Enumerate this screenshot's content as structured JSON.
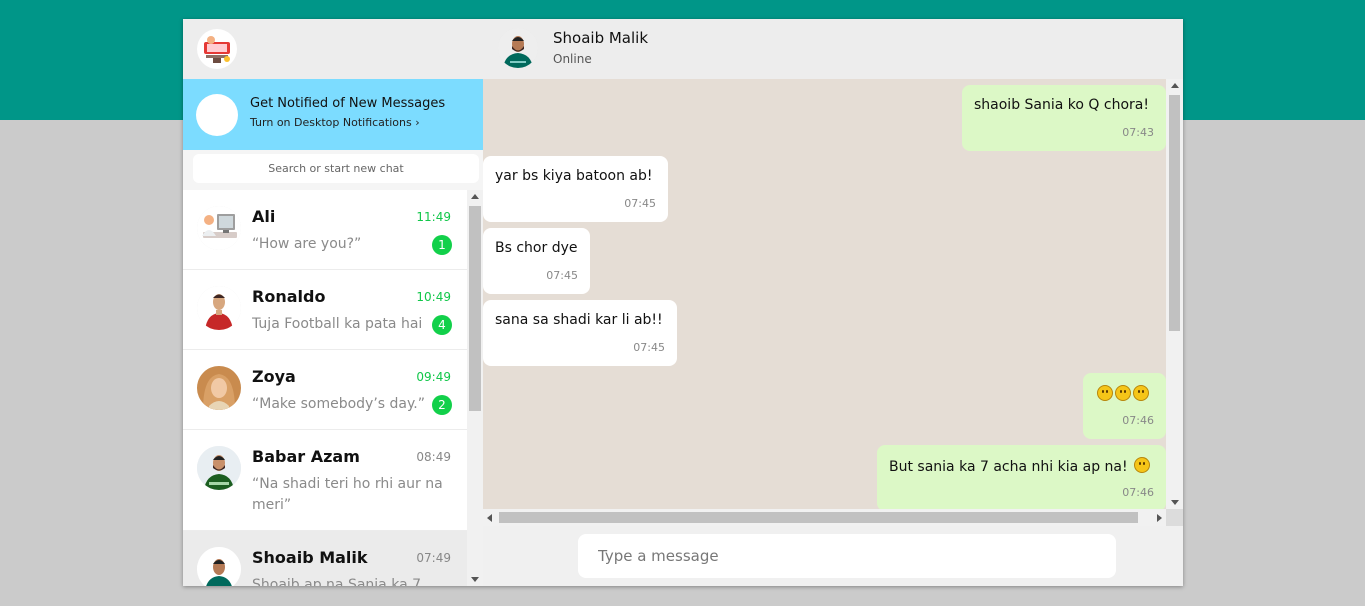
{
  "sidebar": {
    "notification": {
      "title": "Get Notified of New Messages",
      "subtitle": "Turn on Desktop Notifications ›"
    },
    "search": {
      "placeholder": "Search or start new chat"
    },
    "chats": [
      {
        "name": "Ali",
        "time": "11:49",
        "preview": "“How are you?”",
        "unread": "1"
      },
      {
        "name": "Ronaldo",
        "time": "10:49",
        "preview": "Tuja Football ka pata hai",
        "unread": "4"
      },
      {
        "name": "Zoya",
        "time": "09:49",
        "preview": "“Make somebody’s day.”",
        "unread": "2"
      },
      {
        "name": "Babar Azam",
        "time": "08:49",
        "preview": "“Na shadi teri ho rhi aur na meri”",
        "unread": ""
      },
      {
        "name": "Shoaib Malik",
        "time": "07:49",
        "preview": "Shoaib ap na Sania ka 7",
        "unread": ""
      }
    ]
  },
  "conversation": {
    "contact_name": "Shoaib Malik",
    "contact_status": "Online",
    "messages": [
      {
        "direction": "out",
        "text": "shaoib Sania ko Q chora!",
        "time": "07:43"
      },
      {
        "direction": "in",
        "text": "yar bs kiya batoon ab!",
        "time": "07:45"
      },
      {
        "direction": "in",
        "text": "Bs chor dye",
        "time": "07:45"
      },
      {
        "direction": "in",
        "text": "sana sa shadi kar li ab!!",
        "time": "07:45"
      },
      {
        "direction": "out",
        "text": "",
        "time": "07:46",
        "emoji": [
          "neutral-face-emoji",
          "neutral-face-emoji",
          "neutral-face-emoji"
        ]
      },
      {
        "direction": "out",
        "text": "But sania ka 7 acha nhi kia ap na!",
        "time": "07:46",
        "emoji": [
          "smiling-face-emoji"
        ]
      }
    ],
    "composer": {
      "placeholder": "Type a message"
    }
  },
  "colors": {
    "brand": "#009688",
    "incoming_bubble": "#ffffff",
    "outgoing_bubble": "#dcf8c6",
    "chat_background": "#e5ddd5",
    "notification_banner": "#7cdcff",
    "unread_badge": "#12d04a"
  }
}
